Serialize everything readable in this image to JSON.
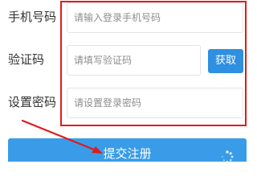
{
  "form": {
    "phone": {
      "label": "手机号码",
      "placeholder": "请输入登录手机号码",
      "value": ""
    },
    "code": {
      "label": "验证码",
      "placeholder": "请填写验证码",
      "value": "",
      "button_label": "获取"
    },
    "password": {
      "label": "设置密码",
      "placeholder": "请设置登录密码",
      "value": ""
    },
    "submit_label": "提交注册"
  },
  "annotation": {
    "highlight_color": "#e01b1b",
    "arrow_target": "submit-button"
  },
  "colors": {
    "primary": "#3a9ce8",
    "button": "#2f8fe0"
  }
}
